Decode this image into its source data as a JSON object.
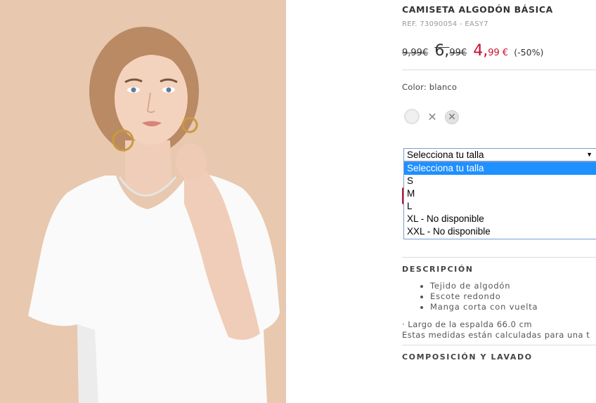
{
  "product": {
    "title": "CAMISETA ALGODÓN BÁSICA",
    "ref": "REF. 73090054 - EASY7",
    "prices": {
      "original": "9,99€",
      "previous_whole": "6,",
      "previous_cents": "99€",
      "current_whole": "4,",
      "current_cents": "99 €",
      "discount": "(-50%)"
    },
    "price_color": "#c8102e",
    "image_alt": "Modelo con camiseta blanca de algodón"
  },
  "color": {
    "label": "Color: blanco",
    "swatches": [
      "blanco",
      "no-disponible",
      "no-disponible"
    ]
  },
  "size_select": {
    "selected": "Selecciona tu talla",
    "options": [
      "Selecciona tu talla",
      "S",
      "M",
      "L",
      "XL - No disponible",
      "XXL - No disponible"
    ],
    "highlight_color": "#1e90ff"
  },
  "description": {
    "title": "DESCRIPCIÓN",
    "bullets": [
      "Tejido de algodón",
      "Escote redondo",
      "Manga corta con vuelta"
    ],
    "measure_line1": "· Largo de la espalda 66.0 cm",
    "measure_line2": "Estas medidas están calculadas para una t"
  },
  "composition": {
    "title": "COMPOSICIÓN Y LAVADO"
  }
}
